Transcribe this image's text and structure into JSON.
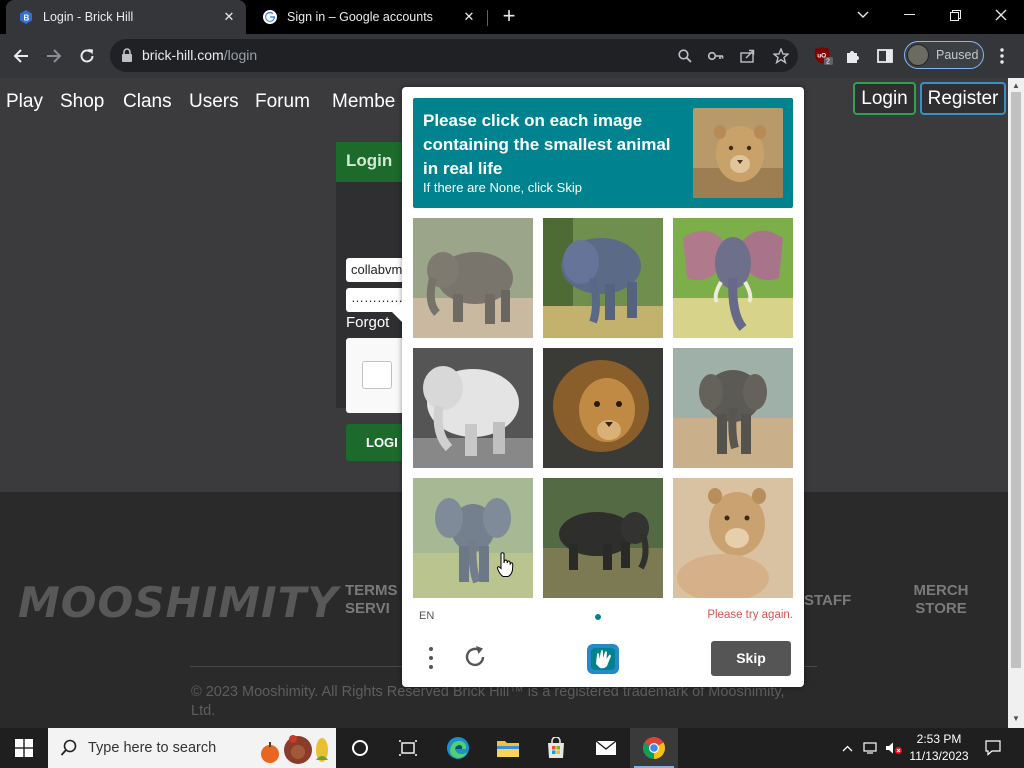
{
  "browser": {
    "tabs": [
      {
        "title": "Login - Brick Hill",
        "icon": "brick-hill-favicon"
      },
      {
        "title": "Sign in – Google accounts",
        "icon": "google-favicon"
      }
    ],
    "url_host": "brick-hill.com",
    "url_path": "/login",
    "profile_label": "Paused",
    "extension_badge": "2"
  },
  "site": {
    "nav": [
      "Play",
      "Shop",
      "Clans",
      "Users",
      "Forum",
      "Membe"
    ],
    "login_button": "Login",
    "register_button": "Register",
    "login_card": {
      "title": "Login",
      "username_value": "collabvm",
      "password_value": "…………",
      "forgot_label": "Forgot",
      "submit_label": "LOGI"
    },
    "footer": {
      "logo": "MOOSHIMITY",
      "links": [
        "TERMS\nSERVI",
        "STAFF",
        "MERCH\nSTORE"
      ],
      "copyright": "© 2023 Mooshimity. All Rights Reserved Brick Hill™ is a registered trademark of Mooshimity, Ltd."
    }
  },
  "captcha": {
    "prompt": "Please click on each image containing the smallest animal in real life",
    "sub": "If there are None, click Skip",
    "example_image": "lioness",
    "images": [
      "elephant",
      "elephant",
      "elephant-painting",
      "elephant",
      "lion",
      "elephant",
      "elephant",
      "elephant",
      "lioness"
    ],
    "language": "EN",
    "error": "Please try again.",
    "skip_label": "Skip",
    "accent": "#00838f"
  },
  "taskbar": {
    "search_placeholder": "Type here to search",
    "time": "2:53 PM",
    "date": "11/13/2023"
  }
}
